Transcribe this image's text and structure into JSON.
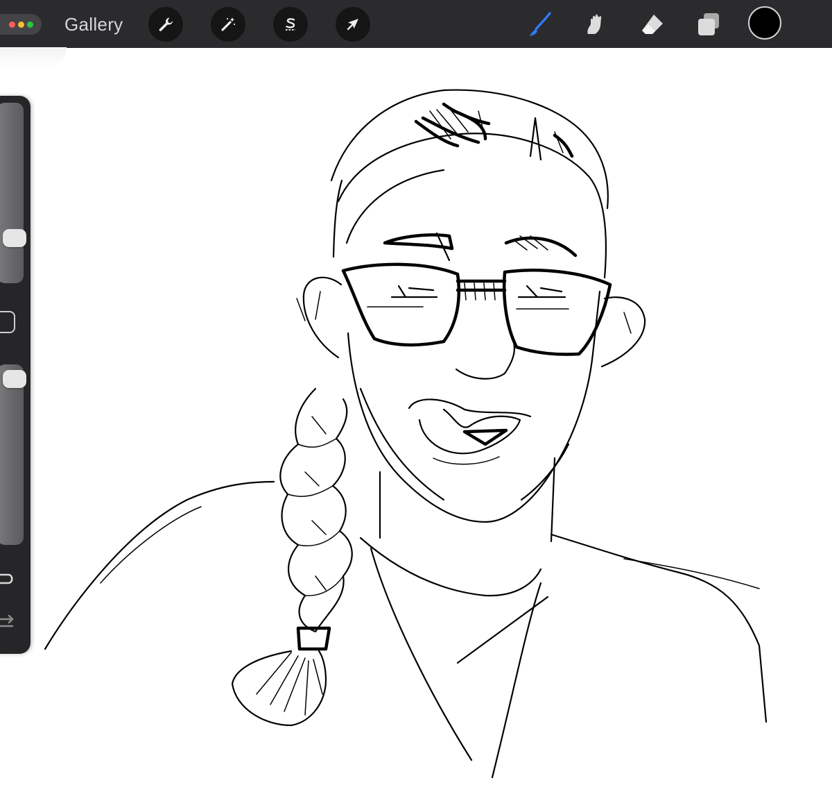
{
  "app": {
    "gallery_label": "Gallery",
    "window_dot_colors": [
      "#ff5f57",
      "#febc2e",
      "#28c840"
    ]
  },
  "toolbar": {
    "left_tools": [
      {
        "name": "actions",
        "icon": "wrench-icon"
      },
      {
        "name": "adjustments",
        "icon": "magic-wand-icon"
      },
      {
        "name": "selection",
        "icon": "selection-s-icon"
      },
      {
        "name": "transform",
        "icon": "arrow-cursor-icon"
      }
    ],
    "right_tools": [
      {
        "name": "brush",
        "icon": "brush-icon",
        "active": true
      },
      {
        "name": "smudge",
        "icon": "smudge-icon",
        "active": false
      },
      {
        "name": "eraser",
        "icon": "eraser-icon",
        "active": false
      },
      {
        "name": "layers",
        "icon": "layers-icon",
        "active": false
      }
    ],
    "active_color": "#000000",
    "active_tool_color": "#2f7bff"
  },
  "sidebar": {
    "brush_size_level": 0.2,
    "brush_opacity_level": 1.0,
    "items": [
      {
        "name": "brush-size-slider"
      },
      {
        "name": "modify-button"
      },
      {
        "name": "opacity-slider"
      },
      {
        "name": "undo"
      },
      {
        "name": "redo"
      }
    ]
  },
  "canvas": {
    "background": "#ffffff",
    "subject": "line-drawing-portrait",
    "ink_color": "#000000"
  }
}
